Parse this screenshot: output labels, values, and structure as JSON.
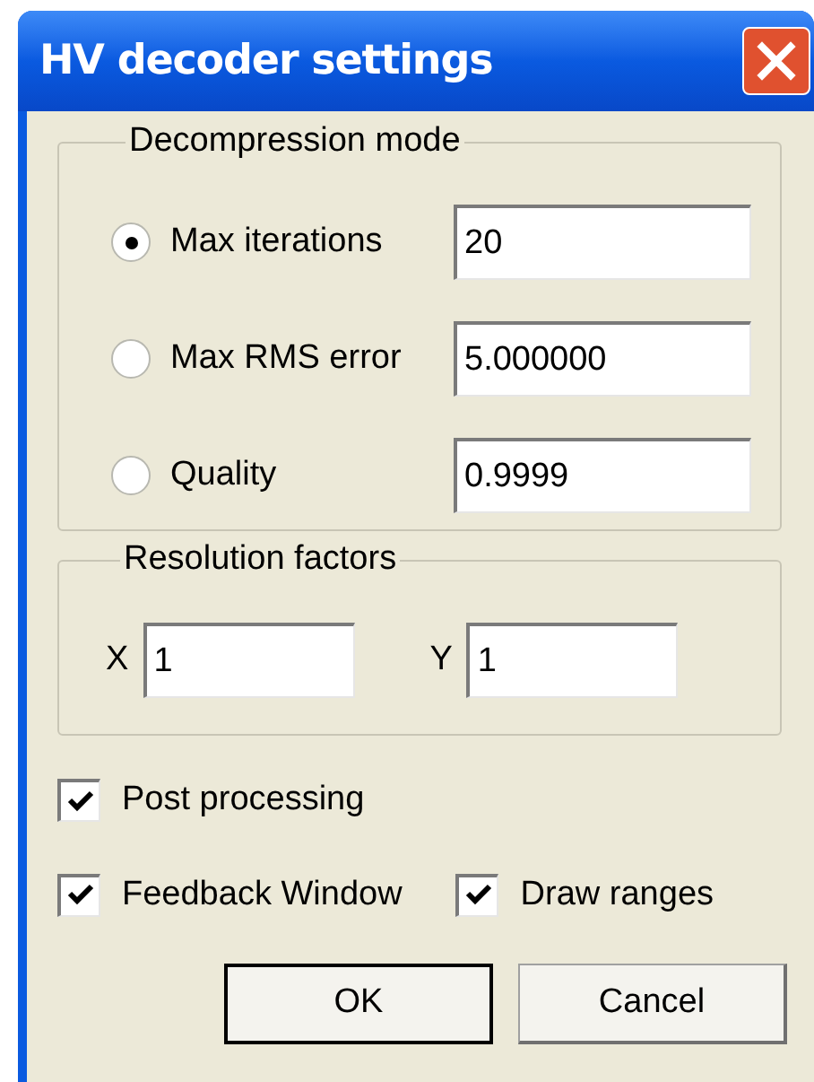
{
  "window": {
    "title": "HV decoder settings"
  },
  "decompression_mode": {
    "label": "Decompression mode",
    "options": [
      {
        "label": "Max iterations",
        "selected": true,
        "value": "20"
      },
      {
        "label": "Max RMS error",
        "selected": false,
        "value": "5.000000"
      },
      {
        "label": "Quality",
        "selected": false,
        "value": "0.9999"
      }
    ]
  },
  "resolution_factors": {
    "label": "Resolution factors",
    "fields": [
      {
        "label": "X",
        "value": "1"
      },
      {
        "label": "Y",
        "value": "1"
      }
    ]
  },
  "option_rows": [
    [
      {
        "label": "Post processing",
        "checked": true
      }
    ],
    [
      {
        "label": "Feedback Window",
        "checked": true
      },
      {
        "label": "Draw ranges",
        "checked": true
      }
    ]
  ],
  "buttons": [
    {
      "label": "OK",
      "default": true
    },
    {
      "label": "Cancel",
      "default": false
    }
  ]
}
